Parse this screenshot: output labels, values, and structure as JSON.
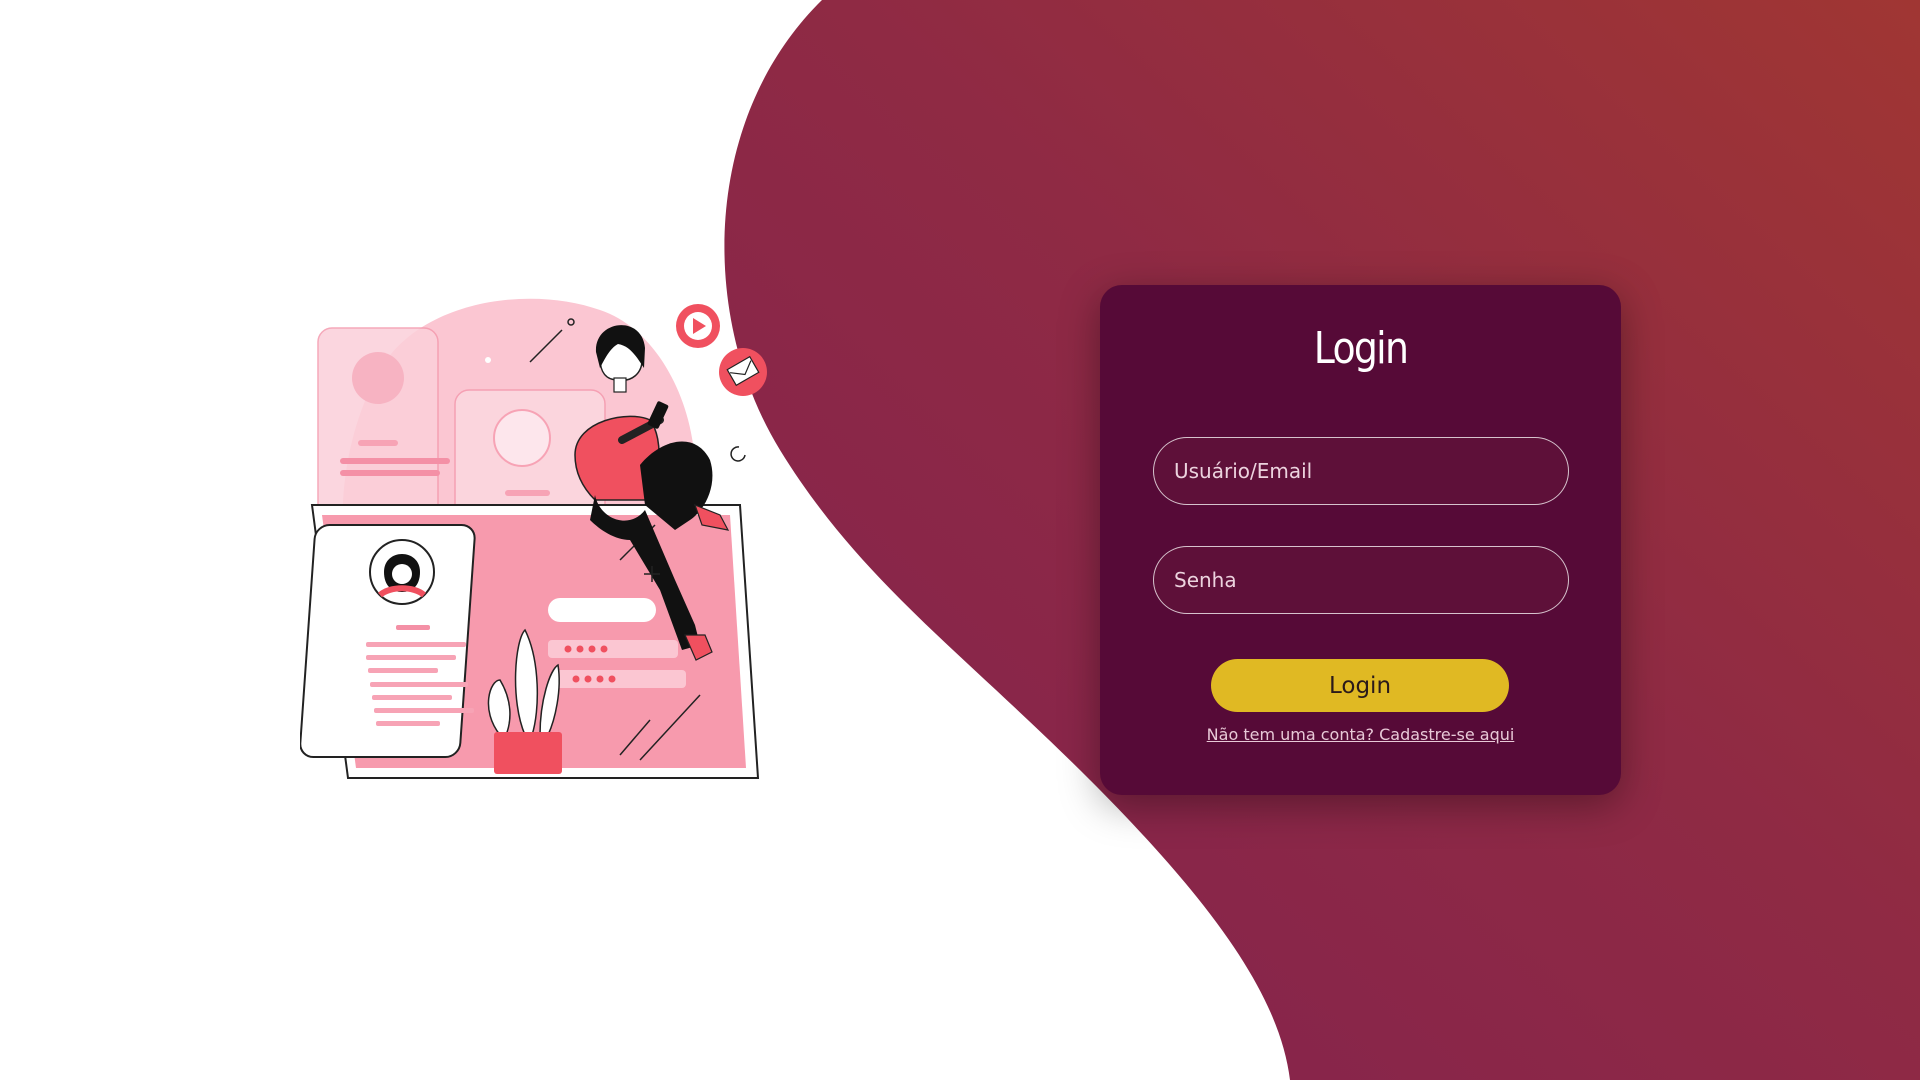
{
  "colors": {
    "wave_dark": "#8a2550",
    "wave_light": "#9c3535",
    "card": "#560a37",
    "button": "#e0b923",
    "illustration_pink": "#f7a3b5",
    "illustration_red": "#f0505f"
  },
  "login_card": {
    "title": "Login",
    "username_placeholder": "Usuário/Email",
    "password_placeholder": "Senha",
    "submit_label": "Login",
    "signup_link": "Não tem uma conta? Cadastre-se aqui"
  },
  "illustration": {
    "icons": [
      "play-icon",
      "envelope-icon",
      "avatar-icon"
    ]
  }
}
